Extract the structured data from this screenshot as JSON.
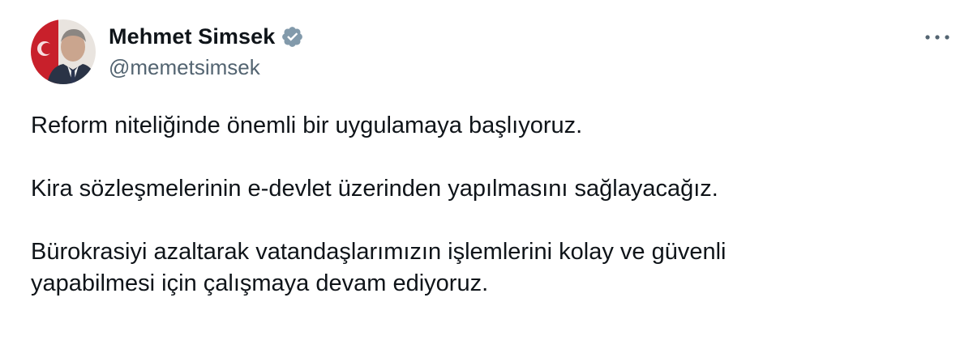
{
  "author": {
    "display_name": "Mehmet Simsek",
    "handle": "@memetsimsek",
    "verified": true
  },
  "tweet": {
    "paragraphs": [
      "Reform niteliğinde önemli bir uygulamaya başlıyoruz.",
      "Kira sözleşmelerinin e-devlet üzerinden yapılmasını sağlayacağız.",
      "Bürokrasiyi azaltarak vatandaşlarımızın işlemlerini kolay ve güvenli\nyapabilmesi için çalışmaya devam ediyoruz."
    ]
  },
  "icons": {
    "verified": "verified-badge-icon",
    "more": "more-options-icon"
  },
  "colors": {
    "text_primary": "#0f1419",
    "text_secondary": "#536471",
    "verified_badge": "#829aab"
  }
}
